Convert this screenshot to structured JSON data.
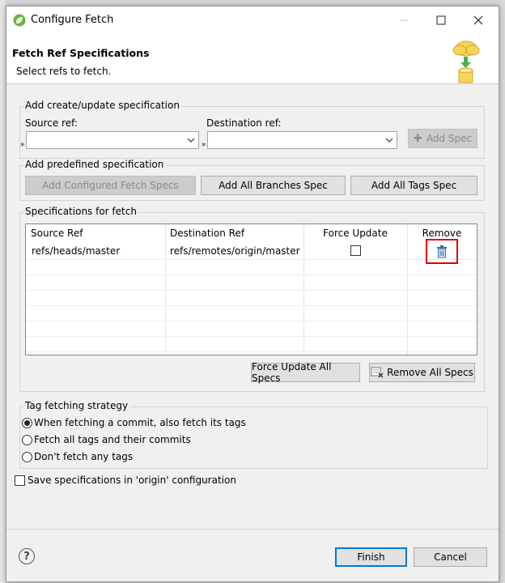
{
  "window": {
    "title": "Configure Fetch"
  },
  "header": {
    "title": "Fetch Ref Specifications",
    "subtitle": "Select refs to fetch."
  },
  "create_group": {
    "label": "Add create/update specification",
    "source_label": "Source ref:",
    "source_value": "",
    "dest_label": "Destination ref:",
    "dest_value": "",
    "required_marker": "*",
    "add_spec": "Add Spec"
  },
  "predefined_group": {
    "label": "Add predefined specification",
    "buttons": [
      "Add Configured Fetch Specs",
      "Add All Branches Spec",
      "Add All Tags Spec"
    ]
  },
  "specs_group": {
    "label": "Specifications for fetch",
    "columns": [
      "Source Ref",
      "Destination Ref",
      "Force Update",
      "Remove"
    ],
    "rows": [
      {
        "source": "refs/heads/master",
        "destination": "refs/remotes/origin/master",
        "force_update": false
      }
    ],
    "force_update_all": "Force Update All Specs",
    "remove_all": "Remove All Specs"
  },
  "tag_group": {
    "label": "Tag fetching strategy",
    "options": [
      "When fetching a commit, also fetch its tags",
      "Fetch all tags and their commits",
      "Don't fetch any tags"
    ],
    "selected_index": 0
  },
  "save_config": {
    "label": "Save specifications in 'origin' configuration",
    "checked": false
  },
  "footer": {
    "finish": "Finish",
    "cancel": "Cancel"
  },
  "colors": {
    "accent": "#0078d7",
    "highlight": "#e00000"
  },
  "icons": [
    "spring-app-icon",
    "minimize-icon",
    "maximize-icon",
    "close-icon",
    "cloud-fetch-icon",
    "trash-icon",
    "help-icon",
    "chevron-down-icon",
    "remove-all-icon"
  ]
}
